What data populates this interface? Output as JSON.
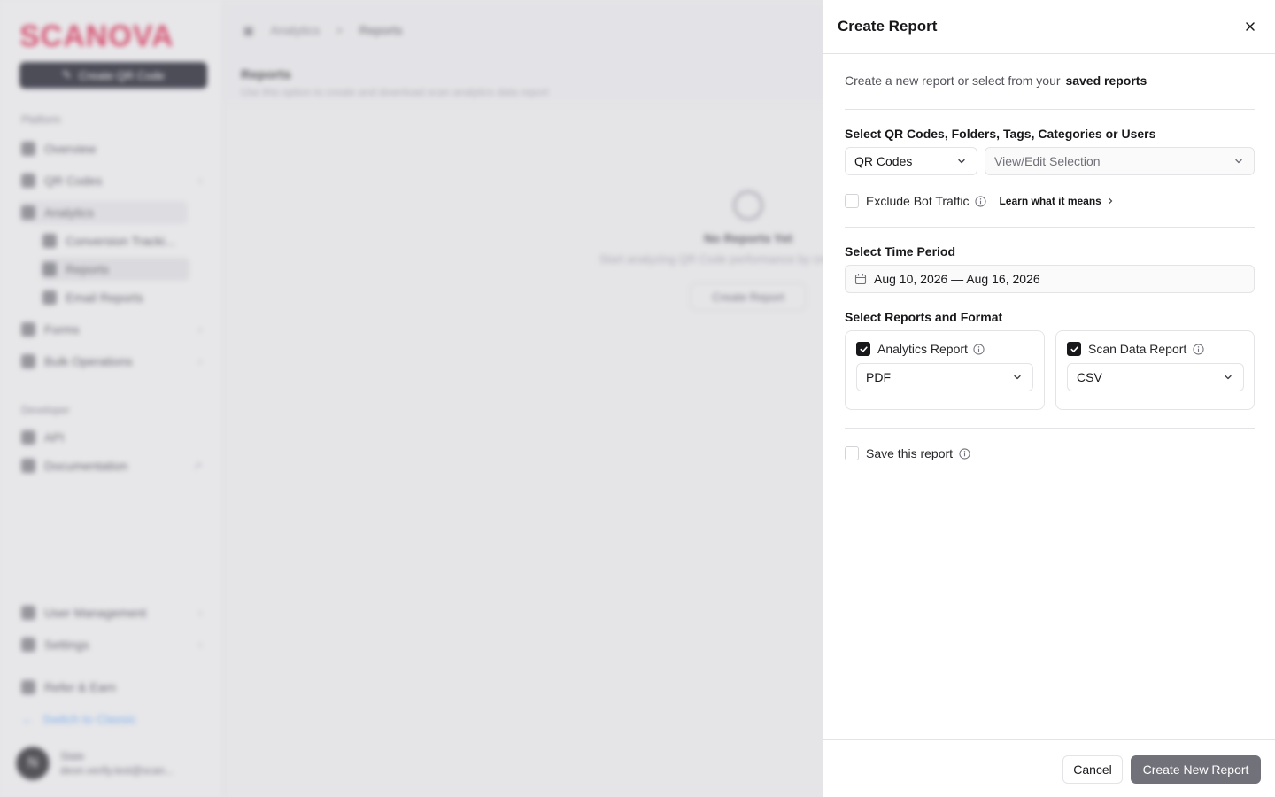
{
  "background": {
    "logo_text": "SCANOVA",
    "create_qr_label": "Create QR Code",
    "sections": {
      "platform": "Platform",
      "developer": "Developer"
    },
    "nav": {
      "overview": "Overview",
      "qr_codes": "QR Codes",
      "analytics": "Analytics",
      "conversion_tracking": "Conversion Tracki...",
      "reports": "Reports",
      "email_reports": "Email Reports",
      "forms": "Forms",
      "bulk_operations": "Bulk Operations",
      "api": "API",
      "documentation": "Documentation",
      "user_management": "User Management",
      "settings": "Settings",
      "refer_earn": "Refer & Earn",
      "switch_classic": "Switch to Classic"
    },
    "user": {
      "initial": "N",
      "name": "Slate",
      "email": "deon.verify.test@scan..."
    },
    "breadcrumb": {
      "parent": "Analytics",
      "separator": ">",
      "current": "Reports"
    },
    "page_title": "Reports",
    "page_subtitle": "Use this option to create and download scan analytics data report",
    "empty_state": {
      "title": "No Reports Yet",
      "subtitle": "Start analyzing QR Code performance by creating a report",
      "button_label": "Create Report"
    }
  },
  "drawer": {
    "title": "Create Report",
    "intro_text": "Create a new report or select from your",
    "intro_link": "saved reports",
    "selection": {
      "label": "Select QR Codes, Folders, Tags, Categories or Users",
      "type_value": "QR Codes",
      "selection_placeholder": "View/Edit Selection"
    },
    "exclude_bot": {
      "label": "Exclude Bot Traffic",
      "checked": false,
      "learn_link": "Learn what it means"
    },
    "time_period": {
      "label": "Select Time Period",
      "value": "Aug 10, 2026 — Aug 16, 2026"
    },
    "reports_format": {
      "label": "Select Reports and Format",
      "analytics": {
        "label": "Analytics Report",
        "checked": true,
        "format": "PDF"
      },
      "scan_data": {
        "label": "Scan Data Report",
        "checked": true,
        "format": "CSV"
      }
    },
    "save_report": {
      "label": "Save this report",
      "checked": false
    },
    "buttons": {
      "cancel": "Cancel",
      "create": "Create New Report"
    }
  }
}
